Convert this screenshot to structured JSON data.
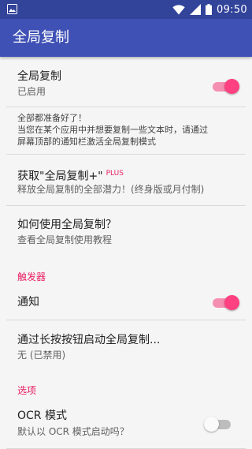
{
  "statusbar": {
    "time": "09:50"
  },
  "appbar": {
    "title": "全局复制"
  },
  "colors": {
    "primary": "#3f51b5",
    "primary_dark": "#32439a",
    "accent": "#ff4081"
  },
  "items": {
    "global_copy": {
      "title": "全局复制",
      "subtitle": "已启用",
      "enabled": true
    },
    "ready_note": {
      "line1": "全部都准备好了！",
      "line2": "当您在某个应用中并想要复制一些文本时，请通过",
      "line3": "屏幕顶部的通知栏激活全局复制模式"
    },
    "get_plus": {
      "title": "获取\"全局复制+\"",
      "badge": "PLUS",
      "subtitle": "释放全局复制的全部潜力！(终身版或月付制)"
    },
    "how_to": {
      "title": "如何使用全局复制？",
      "subtitle": "查看全局复制使用教程"
    },
    "triggers_header": "触发器",
    "notification": {
      "title": "通知",
      "enabled": true
    },
    "long_press": {
      "title": "通过长按按钮启动全局复制...",
      "subtitle": "无 (已禁用)"
    },
    "options_header": "选项",
    "ocr": {
      "title": "OCR 模式",
      "subtitle": "默认以 OCR 模式启动吗？",
      "enabled": false
    }
  },
  "icons": {
    "statusbar_left": "image-icon",
    "wifi": "wifi-icon",
    "signal": "signal-icon",
    "battery": "battery-icon"
  }
}
